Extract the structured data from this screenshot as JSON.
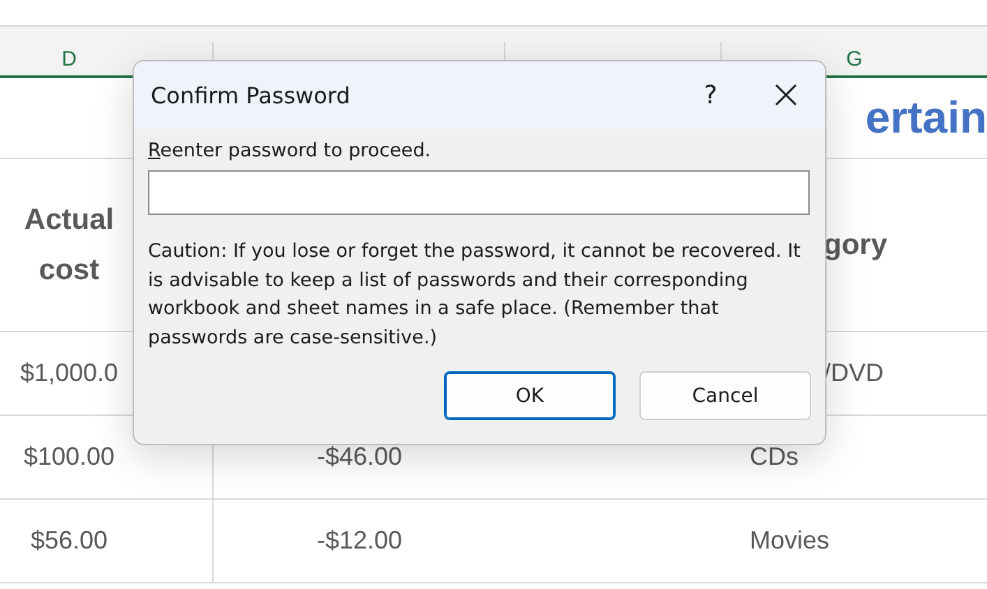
{
  "sheet": {
    "columns": [
      {
        "label": "D"
      },
      {
        "label": "G"
      }
    ],
    "title_fragment": "ertain",
    "rows": [
      {
        "cells": [
          {
            "text": "Actual cost",
            "kind": "header"
          },
          {
            "text": "",
            "kind": "empty"
          },
          {
            "text": "",
            "kind": "empty"
          },
          {
            "text": "gory",
            "kind": "header-partial"
          }
        ]
      },
      {
        "cells": [
          {
            "text": "$1,000.0",
            "kind": "value"
          },
          {
            "text": "",
            "kind": "empty"
          },
          {
            "text": "",
            "kind": "empty"
          },
          {
            "text": "/DVD",
            "kind": "partial"
          }
        ]
      },
      {
        "cells": [
          {
            "text": "$100.00",
            "kind": "value"
          },
          {
            "text": "-$46.00",
            "kind": "value"
          },
          {
            "text": "",
            "kind": "empty"
          },
          {
            "text": "CDs",
            "kind": "label"
          }
        ]
      },
      {
        "cells": [
          {
            "text": "$56.00",
            "kind": "value"
          },
          {
            "text": "-$12.00",
            "kind": "value"
          },
          {
            "text": "",
            "kind": "empty"
          },
          {
            "text": "Movies",
            "kind": "label"
          }
        ]
      }
    ]
  },
  "dialog": {
    "title": "Confirm Password",
    "help": "?",
    "prompt": {
      "label": "Reenter password to proceed.",
      "underline_first": true
    },
    "caution": "Caution: If you lose or forget the password, it cannot be recovered. It is advisable to keep a list of passwords and their corresponding workbook and sheet names in a safe place.  (Remember that passwords are case-sensitive.)",
    "buttons": [
      {
        "label": "OK",
        "selected": true
      },
      {
        "label": "Cancel",
        "selected": false
      }
    ]
  }
}
